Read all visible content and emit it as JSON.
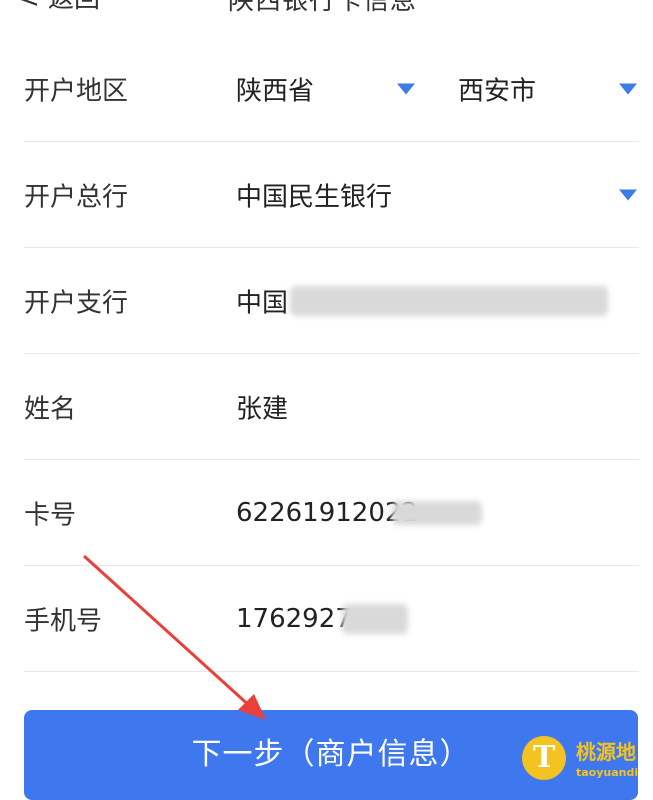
{
  "header": {
    "back_label": "< 返回",
    "title": "陕西银行卡信息"
  },
  "form": {
    "region": {
      "label": "开户地区",
      "province": "陕西省",
      "city": "西安市"
    },
    "bank": {
      "label": "开户总行",
      "value": "中国民生银行"
    },
    "branch": {
      "label": "开户支行",
      "value_visible": "中国"
    },
    "name": {
      "label": "姓名",
      "value": "张建"
    },
    "card": {
      "label": "卡号",
      "value_visible": "62261912022"
    },
    "phone": {
      "label": "手机号",
      "value_visible": "1762927"
    }
  },
  "next_button": {
    "label": "下一步（商户信息）"
  },
  "watermark": {
    "icon_letter": "T",
    "brand_cn": "桃源地",
    "brand_en": "taoyuandi"
  },
  "colors": {
    "accent": "#3f78ee",
    "dropdown": "#3d7be8",
    "watermark": "#f3c322",
    "annotation_arrow": "#e8403a"
  }
}
